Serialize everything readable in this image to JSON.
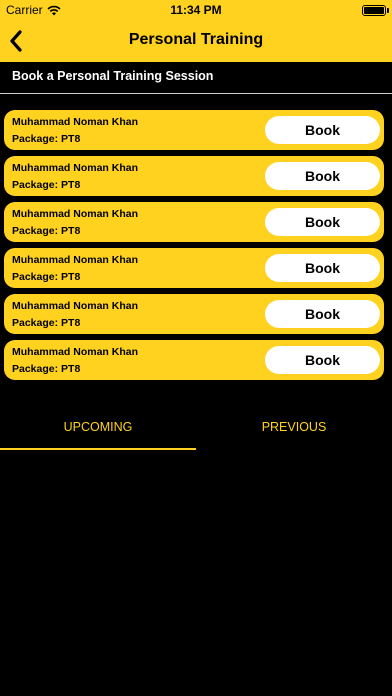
{
  "status_bar": {
    "carrier": "Carrier",
    "time": "11:34 PM"
  },
  "nav": {
    "title": "Personal Training",
    "back_icon": "chevron-left-icon"
  },
  "section": {
    "header": "Book a Personal Training Session"
  },
  "sessions": [
    {
      "trainer": "Muhammad Noman Khan",
      "package": "Package: PT8",
      "action": "Book"
    },
    {
      "trainer": "Muhammad Noman Khan",
      "package": "Package: PT8",
      "action": "Book"
    },
    {
      "trainer": "Muhammad Noman Khan",
      "package": "Package: PT8",
      "action": "Book"
    },
    {
      "trainer": "Muhammad Noman Khan",
      "package": "Package: PT8",
      "action": "Book"
    },
    {
      "trainer": "Muhammad Noman Khan",
      "package": "Package: PT8",
      "action": "Book"
    },
    {
      "trainer": "Muhammad Noman Khan",
      "package": "Package: PT8",
      "action": "Book"
    }
  ],
  "tabs": {
    "items": [
      {
        "label": "UPCOMING",
        "active": true
      },
      {
        "label": "PREVIOUS",
        "active": false
      }
    ]
  },
  "colors": {
    "accent": "#FFD21F",
    "background": "#000000",
    "button": "#FFFFFF"
  }
}
